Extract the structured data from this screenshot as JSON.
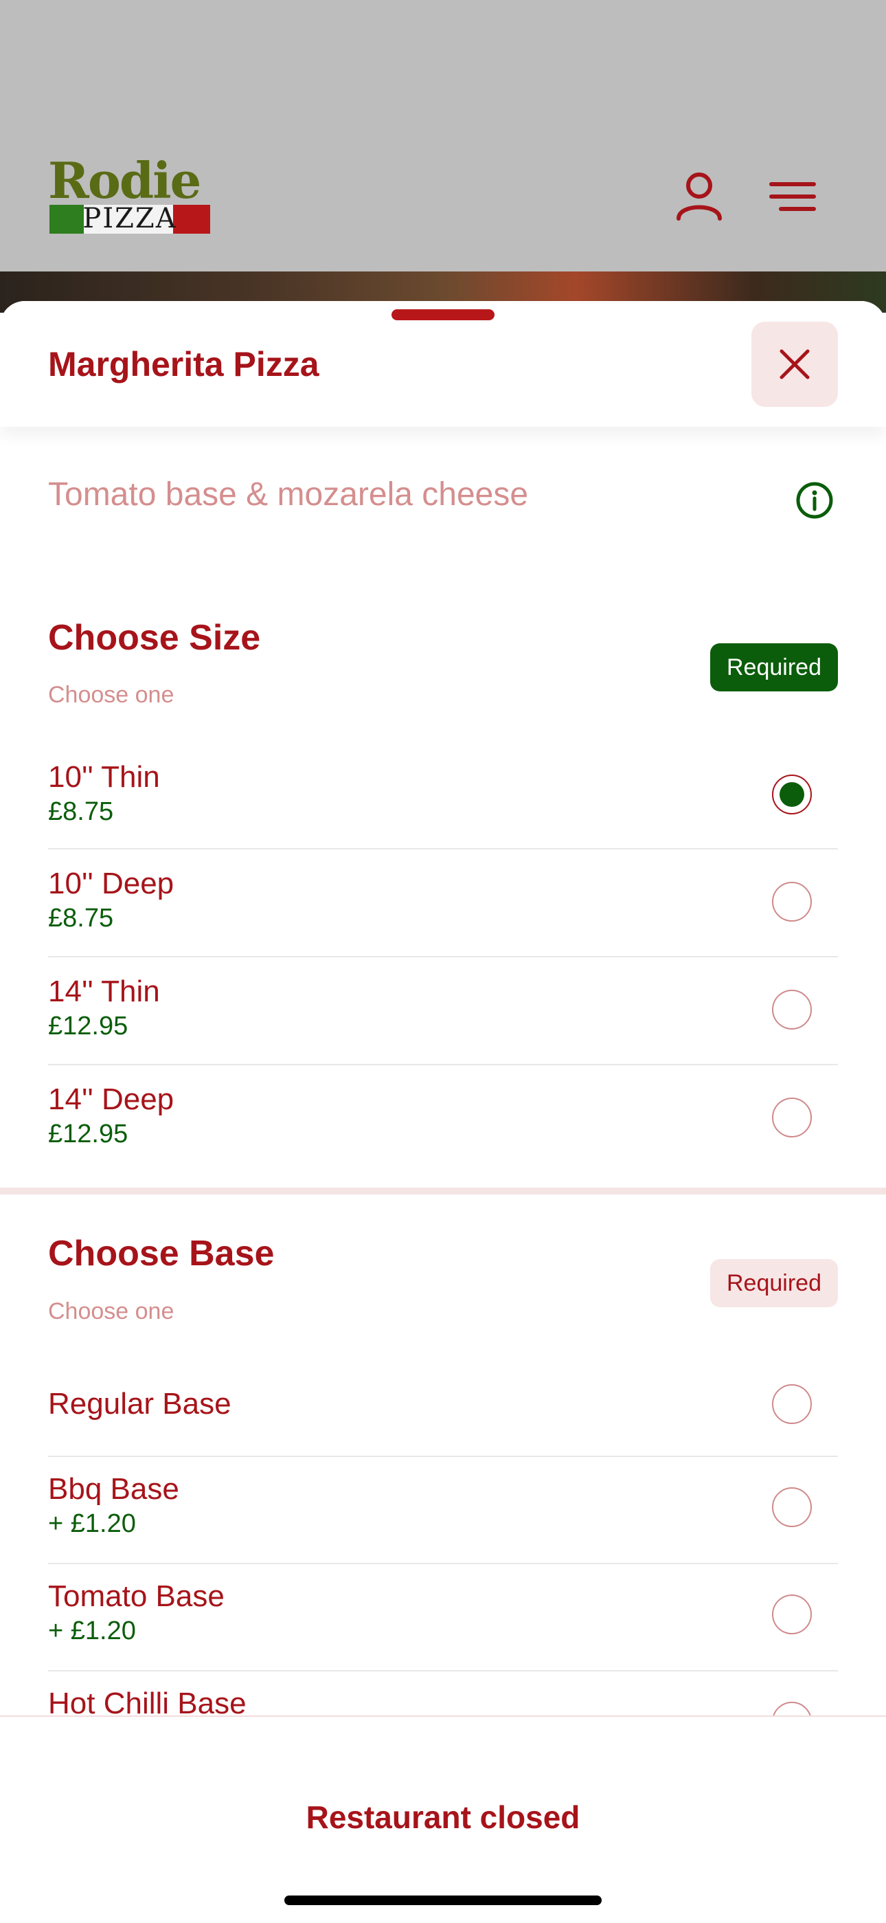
{
  "header": {
    "logo_word": "Rodie",
    "logo_sub": "PIZZA",
    "icons": {
      "account": "user-icon",
      "menu": "hamburger-menu-icon"
    }
  },
  "product": {
    "title": "Margherita Pizza",
    "description": "Tomato base & mozarela cheese"
  },
  "sections": [
    {
      "title": "Choose Size",
      "subtitle": "Choose one",
      "badge": "Required",
      "options": [
        {
          "name": "10'' Thin",
          "price": "£8.75",
          "selected": true
        },
        {
          "name": "10'' Deep",
          "price": "£8.75",
          "selected": false
        },
        {
          "name": "14'' Thin",
          "price": "£12.95",
          "selected": false
        },
        {
          "name": "14'' Deep",
          "price": "£12.95",
          "selected": false
        }
      ]
    },
    {
      "title": "Choose Base",
      "subtitle": "Choose one",
      "badge": "Required",
      "options": [
        {
          "name": "Regular Base",
          "price": "",
          "selected": false
        },
        {
          "name": "Bbq Base",
          "price": "+ £1.20",
          "selected": false
        },
        {
          "name": "Tomato Base",
          "price": "+ £1.20",
          "selected": false
        },
        {
          "name": "Hot Chilli Base",
          "price": "",
          "selected": false
        }
      ]
    }
  ],
  "footer": {
    "status": "Restaurant closed"
  },
  "colors": {
    "brand_red": "#a6141a",
    "price_green": "#0b5d0b",
    "required_green": "#0b5d0b",
    "pink_bg": "#f7e6e6"
  }
}
